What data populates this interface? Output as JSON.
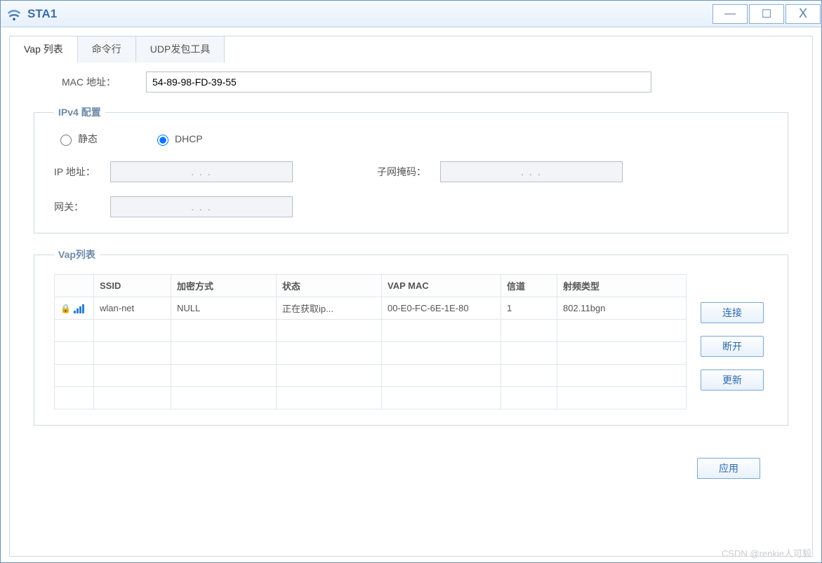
{
  "window": {
    "title": "STA1"
  },
  "tabs": [
    {
      "label": "Vap 列表",
      "active": true
    },
    {
      "label": "命令行",
      "active": false
    },
    {
      "label": "UDP发包工具",
      "active": false
    }
  ],
  "mac_section": {
    "label": "MAC 地址：",
    "value": "54-89-98-FD-39-55"
  },
  "ipv4": {
    "legend": "IPv4 配置",
    "radio_static": "静态",
    "radio_dhcp": "DHCP",
    "selected": "dhcp",
    "ip_label": "IP 地址：",
    "mask_label": "子网掩码：",
    "gw_label": "网关：",
    "ip_value": ".       .       .",
    "mask_value": ".       .       .",
    "gw_value": ".       .       ."
  },
  "vap_list": {
    "legend": "Vap列表",
    "columns": {
      "icon": "",
      "ssid": "SSID",
      "enc": "加密方式",
      "state": "状态",
      "mac": "VAP MAC",
      "chan": "信道",
      "radio": "射频类型"
    },
    "rows": [
      {
        "ssid": "wlan-net",
        "enc": "NULL",
        "state": "正在获取ip...",
        "mac": "00-E0-FC-6E-1E-80",
        "chan": "1",
        "radio": "802.11bgn"
      }
    ]
  },
  "buttons": {
    "connect": "连接",
    "disconnect": "断开",
    "refresh": "更新",
    "apply": "应用"
  },
  "watermark": "CSDN @renkie人可毅"
}
